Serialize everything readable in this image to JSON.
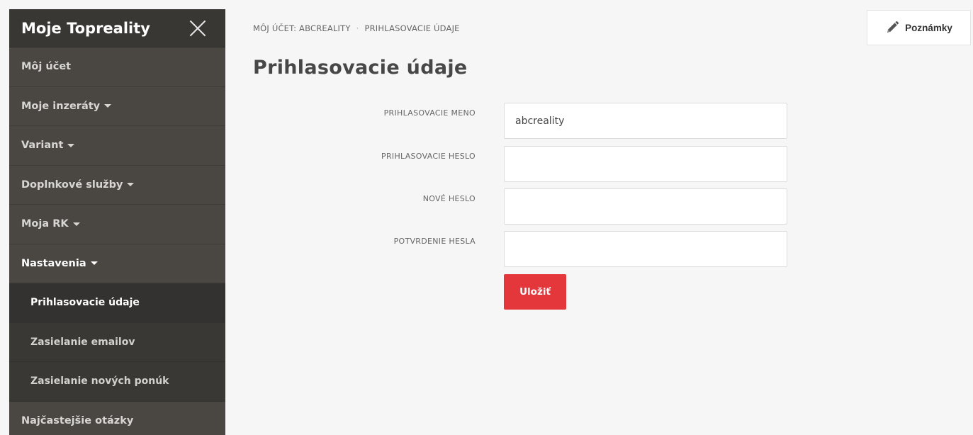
{
  "sidebar": {
    "title": "Moje Topreality",
    "items": [
      {
        "label": "Môj účet"
      },
      {
        "label": "Moje inzeráty"
      },
      {
        "label": "Variant"
      },
      {
        "label": "Doplnkové služby"
      },
      {
        "label": "Moja RK"
      },
      {
        "label": "Nastavenia"
      }
    ],
    "subitems": [
      {
        "label": "Prihlasovacie údaje"
      },
      {
        "label": "Zasielanie emailov"
      },
      {
        "label": "Zasielanie nových ponúk"
      }
    ],
    "bottom_item": {
      "label": "Najčastejšie otázky"
    }
  },
  "breadcrumb": {
    "items": [
      "MÔJ ÚČET: ABCREALITY",
      "PRIHLASOVACIE ÚDAJE"
    ],
    "separator": "·"
  },
  "notes_button": {
    "label": "Poznámky",
    "icon": "pencil-icon"
  },
  "page_title": "Prihlasovacie údaje",
  "form": {
    "fields": [
      {
        "label": "PRIHLASOVACIE MENO",
        "value": "abcreality",
        "placeholder": ""
      },
      {
        "label": "PRIHLASOVACIE HESLO",
        "value": "",
        "placeholder": ""
      },
      {
        "label": "NOVÉ HESLO",
        "value": "",
        "placeholder": ""
      },
      {
        "label": "POTVRDENIE HESLA",
        "value": "",
        "placeholder": ""
      }
    ],
    "save_label": "Uložiť"
  },
  "colors": {
    "accent": "#e3373b",
    "sidebar_bg": "#4a4743",
    "sidebar_header_bg": "#393734"
  }
}
